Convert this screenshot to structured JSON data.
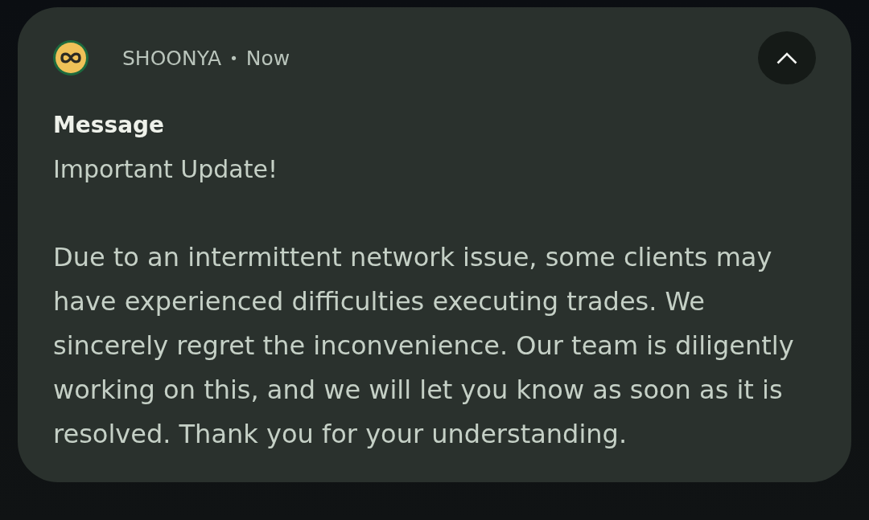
{
  "notification": {
    "app_name": "SHOONYA",
    "separator": "•",
    "time": "Now",
    "expanded": true,
    "title": "Message",
    "subject": "Important Update!",
    "body": "Due to an intermittent network issue, some clients may have experienced difficulties executing trades. We sincerely regret the inconvenience. Our team is diligently working on this, and we will let you know as soon as it is resolved. Thank you for your understanding."
  }
}
